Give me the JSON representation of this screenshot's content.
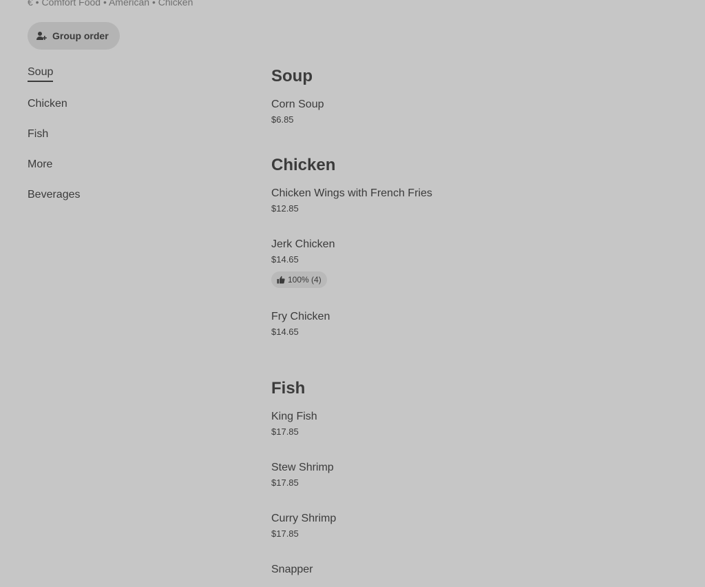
{
  "store": {
    "meta": "€ • Comfort Food • American • Chicken"
  },
  "group_order": {
    "label": "Group order",
    "icon": "person-add-icon"
  },
  "sidebar": {
    "items": [
      {
        "label": "Soup",
        "active": true
      },
      {
        "label": "Chicken"
      },
      {
        "label": "Fish"
      },
      {
        "label": "More"
      },
      {
        "label": "Beverages"
      }
    ]
  },
  "menu": {
    "sections": [
      {
        "title": "Soup",
        "items": [
          {
            "name": "Corn Soup",
            "price": "$6.85"
          }
        ]
      },
      {
        "title": "Chicken",
        "items": [
          {
            "name": "Chicken Wings with French Fries",
            "price": "$12.85"
          },
          {
            "name": "Jerk Chicken",
            "price": "$14.65",
            "rating": "100% (4)"
          },
          {
            "name": "Fry Chicken",
            "price": "$14.65"
          }
        ]
      },
      {
        "title": "Fish",
        "items": [
          {
            "name": "King Fish",
            "price": "$17.85"
          },
          {
            "name": "Stew Shrimp",
            "price": "$17.85"
          },
          {
            "name": "Curry Shrimp",
            "price": "$17.85"
          },
          {
            "name": "Snapper",
            "price": ""
          }
        ]
      }
    ]
  }
}
